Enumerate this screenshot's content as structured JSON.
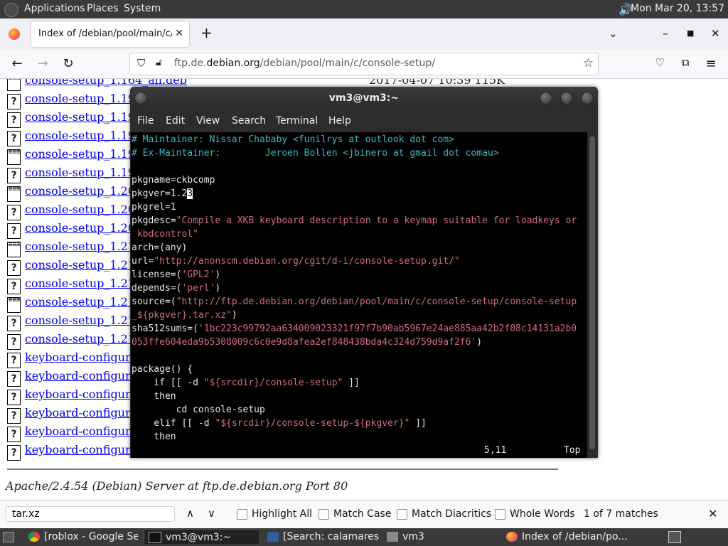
{
  "top_panel": {
    "menus": [
      "Applications",
      "Places",
      "System"
    ],
    "clock": "Mon Mar 20, 13:57"
  },
  "browser": {
    "tab_title": "Index of /debian/pool/main/c/",
    "url_host": "ftp.de.debian.org",
    "url_prefix": "ftp.de.",
    "url_domain": "debian.org",
    "url_path": "/debian/pool/main/c/console-setup/"
  },
  "listing": {
    "rows": [
      {
        "name": "console-setup_1.164_all.deb",
        "icon": "doc",
        "date": "2017-04-07 10:39 115K"
      },
      {
        "name": "console-setup_1.191",
        "icon": "unknown",
        "date": ""
      },
      {
        "name": "console-setup_1.191",
        "icon": "unknown",
        "date": ""
      },
      {
        "name": "console-setup_1.193",
        "icon": "unknown",
        "date": ""
      },
      {
        "name": "console-setup_1.193",
        "icon": "doc",
        "date": ""
      },
      {
        "name": "console-setup_1.193",
        "icon": "unknown",
        "date": ""
      },
      {
        "name": "console-setup_1.205",
        "icon": "doc",
        "date": ""
      },
      {
        "name": "console-setup_1.205",
        "icon": "unknown",
        "date": ""
      },
      {
        "name": "console-setup_1.205",
        "icon": "unknown",
        "date": ""
      },
      {
        "name": "console-setup_1.217",
        "icon": "doc",
        "date": ""
      },
      {
        "name": "console-setup_1.217",
        "icon": "unknown",
        "date": ""
      },
      {
        "name": "console-setup_1.217",
        "icon": "unknown",
        "date": ""
      },
      {
        "name": "console-setup_1.218",
        "icon": "doc",
        "date": ""
      },
      {
        "name": "console-setup_1.218",
        "icon": "unknown",
        "date": ""
      },
      {
        "name": "console-setup_1.218",
        "icon": "unknown",
        "date": ""
      },
      {
        "name": "keyboard-configura",
        "icon": "unknown",
        "date": ""
      },
      {
        "name": "keyboard-configura",
        "icon": "unknown",
        "date": ""
      },
      {
        "name": "keyboard-configura",
        "icon": "unknown",
        "date": ""
      },
      {
        "name": "keyboard-configura",
        "icon": "unknown",
        "date": ""
      },
      {
        "name": "keyboard-configura",
        "icon": "unknown",
        "date": ""
      },
      {
        "name": "keyboard-configura",
        "icon": "unknown",
        "date": ""
      }
    ],
    "server_signature": "Apache/2.4.54 (Debian) Server at ftp.de.debian.org Port 80"
  },
  "findbar": {
    "query": "tar.xz",
    "highlight_all": "Highlight All",
    "match_case": "Match Case",
    "match_diacritics": "Match Diacritics",
    "whole_words": "Whole Words",
    "result": "1 of 7 matches"
  },
  "taskbar": {
    "items": [
      "[roblox - Google Se...",
      "vm3@vm3:~",
      "[Search: calamares ...",
      "vm3",
      "Index of /debian/po..."
    ]
  },
  "terminal": {
    "title": "vm3@vm3:~",
    "menus": [
      "File",
      "Edit",
      "View",
      "Search",
      "Terminal",
      "Help"
    ],
    "status_pos": "5,11",
    "status_scroll": "Top",
    "lines": [
      [
        {
          "c": "cm",
          "t": "# Maintainer: Nissar Chababy <funilrys at outlook dot com>"
        }
      ],
      [
        {
          "c": "cm",
          "t": "# Ex-Maintainer:        Jeroen Bollen <jbinero at gmail dot comau>"
        }
      ],
      [],
      [
        {
          "c": "",
          "t": "pkgname=ckbcomp"
        }
      ],
      [
        {
          "c": "",
          "t": "pkgver=1.2"
        },
        {
          "c": "cur",
          "t": "3"
        }
      ],
      [
        {
          "c": "",
          "t": "pkgrel=1"
        }
      ],
      [
        {
          "c": "",
          "t": "pkgdesc="
        },
        {
          "c": "st",
          "t": "\"Compile a XKB keyboard description to a keymap suitable for loadkeys or"
        }
      ],
      [
        {
          "c": "st",
          "t": " kbdcontrol\""
        }
      ],
      [
        {
          "c": "",
          "t": "arch=(any)"
        }
      ],
      [
        {
          "c": "",
          "t": "url="
        },
        {
          "c": "st",
          "t": "\"http://anonscm.debian.org/cgit/d-i/console-setup.git/\""
        }
      ],
      [
        {
          "c": "",
          "t": "license=("
        },
        {
          "c": "st",
          "t": "'GPL2'"
        },
        {
          "c": "",
          "t": ")"
        }
      ],
      [
        {
          "c": "",
          "t": "depends=("
        },
        {
          "c": "st",
          "t": "'perl'"
        },
        {
          "c": "",
          "t": ")"
        }
      ],
      [
        {
          "c": "",
          "t": "source=("
        },
        {
          "c": "st",
          "t": "\"http://ftp.de.debian.org/debian/pool/main/c/console-setup/console-setup"
        }
      ],
      [
        {
          "c": "st",
          "t": "_${pkgver}.tar.xz\""
        },
        {
          "c": "",
          "t": ")"
        }
      ],
      [
        {
          "c": "",
          "t": "sha512sums=("
        },
        {
          "c": "st",
          "t": "'1bc223c99792aa634009023321f97f7b90ab5967e24ae885aa42b2f08c14131a2b0"
        }
      ],
      [
        {
          "c": "st",
          "t": "053ffe604eda9b5308009c6c0e9d8afea2ef848438bda4c324d759d9af2f6'"
        },
        {
          "c": "",
          "t": ")"
        }
      ],
      [],
      [
        {
          "c": "",
          "t": "package() {"
        }
      ],
      [
        {
          "c": "",
          "t": "    if [[ -d "
        },
        {
          "c": "st",
          "t": "\"${srcdir}/console-setup\""
        },
        {
          "c": "",
          "t": " ]]"
        }
      ],
      [
        {
          "c": "",
          "t": "    then"
        }
      ],
      [
        {
          "c": "",
          "t": "        cd console-setup"
        }
      ],
      [
        {
          "c": "",
          "t": "    elif [[ -d "
        },
        {
          "c": "st",
          "t": "\"${srcdir}/console-setup-${pkgver}\""
        },
        {
          "c": "",
          "t": " ]]"
        }
      ],
      [
        {
          "c": "",
          "t": "    then"
        }
      ]
    ]
  }
}
